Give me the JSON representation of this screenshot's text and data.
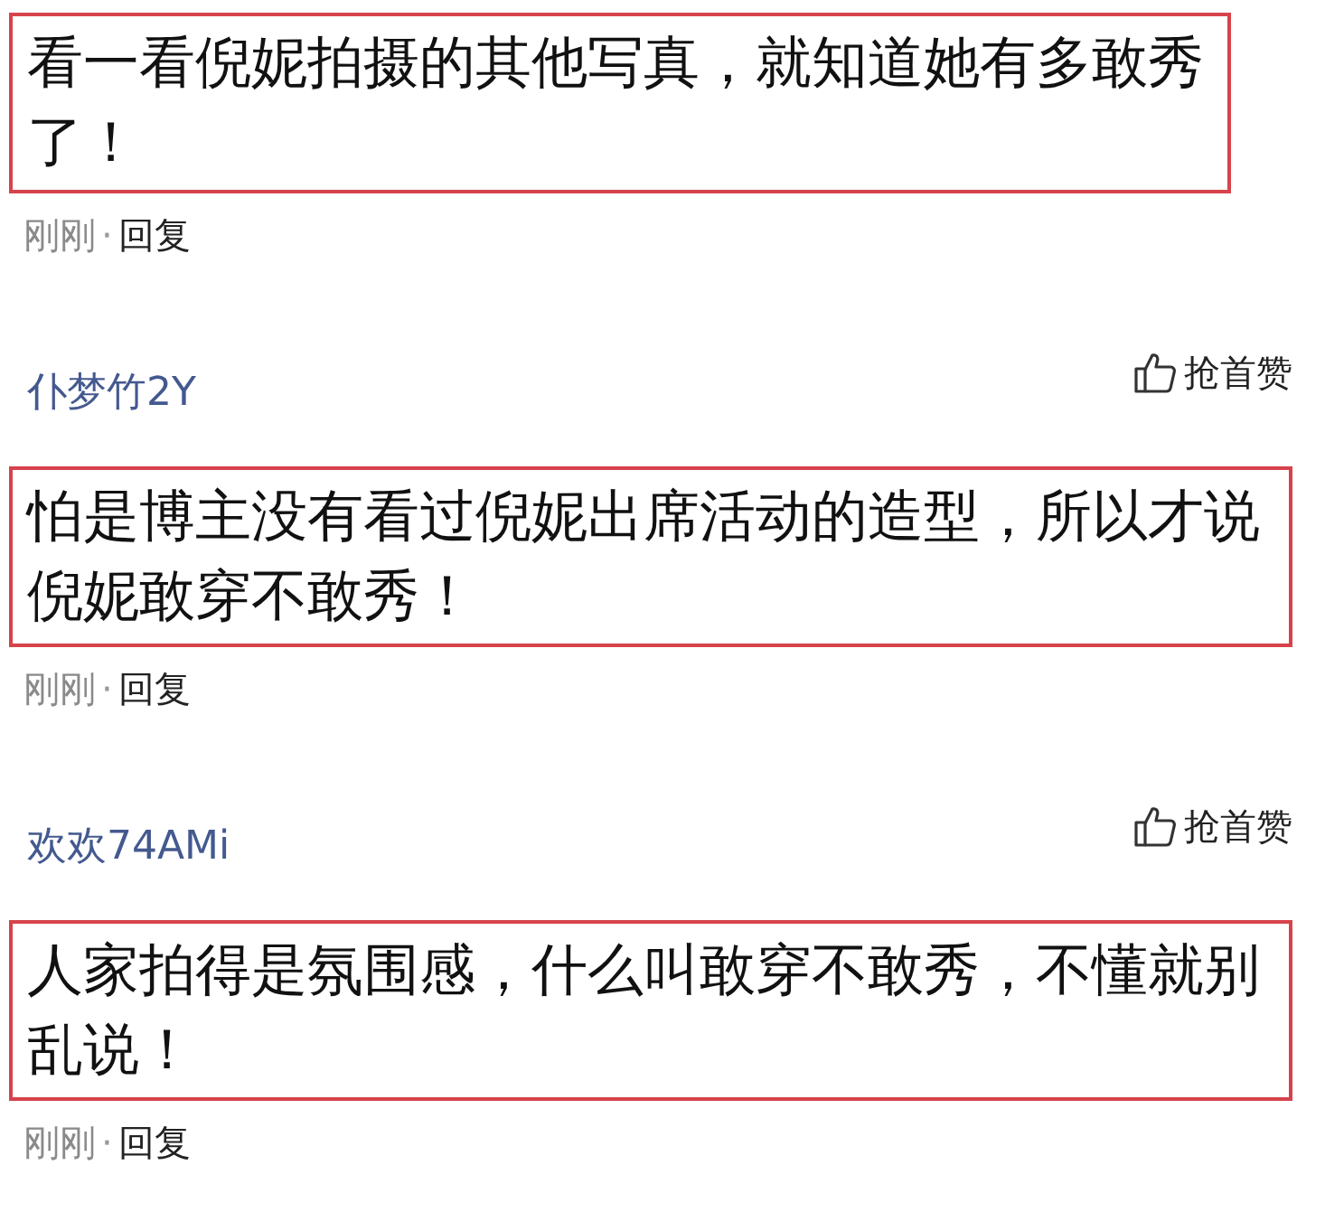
{
  "comments": [
    {
      "text": "看一看倪妮拍摄的其他写真，就知道她有多敢秀了！",
      "time": "刚刚",
      "separator": "·",
      "reply": "回复"
    },
    {
      "author": "仆梦竹2Y",
      "like": "抢首赞",
      "text": "怕是博主没有看过倪妮出席活动的造型，所以才说倪妮敢穿不敢秀！",
      "time": "刚刚",
      "separator": "·",
      "reply": "回复"
    },
    {
      "author": "欢欢74AMi",
      "like": "抢首赞",
      "text": "人家拍得是氛围感，什么叫敢穿不敢秀，不懂就别乱说！",
      "time": "刚刚",
      "separator": "·",
      "reply": "回复"
    }
  ]
}
